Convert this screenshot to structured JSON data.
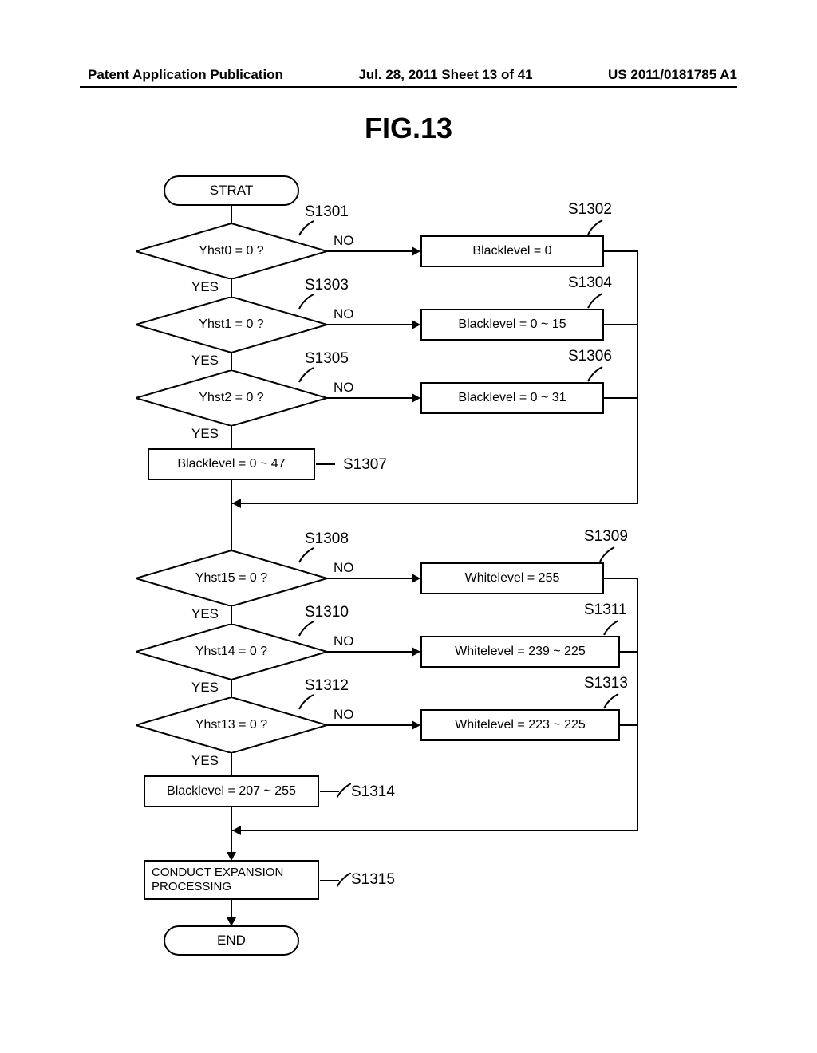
{
  "header": {
    "left": "Patent Application Publication",
    "center": "Jul. 28, 2011  Sheet 13 of 41",
    "right": "US 2011/0181785 A1"
  },
  "figure_title": "FIG.13",
  "terminators": {
    "start": "STRAT",
    "end": "END"
  },
  "decisions": {
    "d1": "Yhst0 = 0 ?",
    "d2": "Yhst1 = 0 ?",
    "d3": "Yhst2 = 0 ?",
    "d4": "Yhst15 = 0 ?",
    "d5": "Yhst14 = 0 ?",
    "d6": "Yhst13 = 0 ?"
  },
  "processes": {
    "p1302": "Blacklevel = 0",
    "p1304": "Blacklevel = 0 ~ 15",
    "p1306": "Blacklevel = 0 ~ 31",
    "p1307": "Blacklevel = 0 ~ 47",
    "p1309": "Whitelevel = 255",
    "p1311": "Whitelevel = 239 ~ 225",
    "p1313": "Whitelevel = 223 ~ 225",
    "p1314": "Blacklevel = 207 ~ 255",
    "p1315": "CONDUCT EXPANSION PROCESSING"
  },
  "labels": {
    "yes": "YES",
    "no": "NO"
  },
  "refs": {
    "s1301": "S1301",
    "s1302": "S1302",
    "s1303": "S1303",
    "s1304": "S1304",
    "s1305": "S1305",
    "s1306": "S1306",
    "s1307": "S1307",
    "s1308": "S1308",
    "s1309": "S1309",
    "s1310": "S1310",
    "s1311": "S1311",
    "s1312": "S1312",
    "s1313": "S1313",
    "s1314": "S1314",
    "s1315": "S1315"
  },
  "chart_data": {
    "type": "flowchart",
    "nodes": [
      {
        "id": "start",
        "kind": "terminator",
        "text": "STRAT"
      },
      {
        "id": "S1301",
        "kind": "decision",
        "text": "Yhst0 = 0 ?"
      },
      {
        "id": "S1302",
        "kind": "process",
        "text": "Blacklevel = 0"
      },
      {
        "id": "S1303",
        "kind": "decision",
        "text": "Yhst1 = 0 ?"
      },
      {
        "id": "S1304",
        "kind": "process",
        "text": "Blacklevel = 0 ~ 15"
      },
      {
        "id": "S1305",
        "kind": "decision",
        "text": "Yhst2 = 0 ?"
      },
      {
        "id": "S1306",
        "kind": "process",
        "text": "Blacklevel = 0 ~ 31"
      },
      {
        "id": "S1307",
        "kind": "process",
        "text": "Blacklevel = 0 ~ 47"
      },
      {
        "id": "merge1",
        "kind": "merge"
      },
      {
        "id": "S1308",
        "kind": "decision",
        "text": "Yhst15 = 0 ?"
      },
      {
        "id": "S1309",
        "kind": "process",
        "text": "Whitelevel = 255"
      },
      {
        "id": "S1310",
        "kind": "decision",
        "text": "Yhst14 = 0 ?"
      },
      {
        "id": "S1311",
        "kind": "process",
        "text": "Whitelevel = 239 ~ 225"
      },
      {
        "id": "S1312",
        "kind": "decision",
        "text": "Yhst13 = 0 ?"
      },
      {
        "id": "S1313",
        "kind": "process",
        "text": "Whitelevel = 223 ~ 225"
      },
      {
        "id": "S1314",
        "kind": "process",
        "text": "Blacklevel = 207 ~ 255"
      },
      {
        "id": "merge2",
        "kind": "merge"
      },
      {
        "id": "S1315",
        "kind": "process",
        "text": "CONDUCT EXPANSION PROCESSING"
      },
      {
        "id": "end",
        "kind": "terminator",
        "text": "END"
      }
    ],
    "edges": [
      {
        "from": "start",
        "to": "S1301"
      },
      {
        "from": "S1301",
        "to": "S1302",
        "label": "NO"
      },
      {
        "from": "S1301",
        "to": "S1303",
        "label": "YES"
      },
      {
        "from": "S1303",
        "to": "S1304",
        "label": "NO"
      },
      {
        "from": "S1303",
        "to": "S1305",
        "label": "YES"
      },
      {
        "from": "S1305",
        "to": "S1306",
        "label": "NO"
      },
      {
        "from": "S1305",
        "to": "S1307",
        "label": "YES"
      },
      {
        "from": "S1302",
        "to": "merge1"
      },
      {
        "from": "S1304",
        "to": "merge1"
      },
      {
        "from": "S1306",
        "to": "merge1"
      },
      {
        "from": "S1307",
        "to": "merge1"
      },
      {
        "from": "merge1",
        "to": "S1308"
      },
      {
        "from": "S1308",
        "to": "S1309",
        "label": "NO"
      },
      {
        "from": "S1308",
        "to": "S1310",
        "label": "YES"
      },
      {
        "from": "S1310",
        "to": "S1311",
        "label": "NO"
      },
      {
        "from": "S1310",
        "to": "S1312",
        "label": "YES"
      },
      {
        "from": "S1312",
        "to": "S1313",
        "label": "NO"
      },
      {
        "from": "S1312",
        "to": "S1314",
        "label": "YES"
      },
      {
        "from": "S1309",
        "to": "merge2"
      },
      {
        "from": "S1311",
        "to": "merge2"
      },
      {
        "from": "S1313",
        "to": "merge2"
      },
      {
        "from": "S1314",
        "to": "merge2"
      },
      {
        "from": "merge2",
        "to": "S1315"
      },
      {
        "from": "S1315",
        "to": "end"
      }
    ]
  }
}
